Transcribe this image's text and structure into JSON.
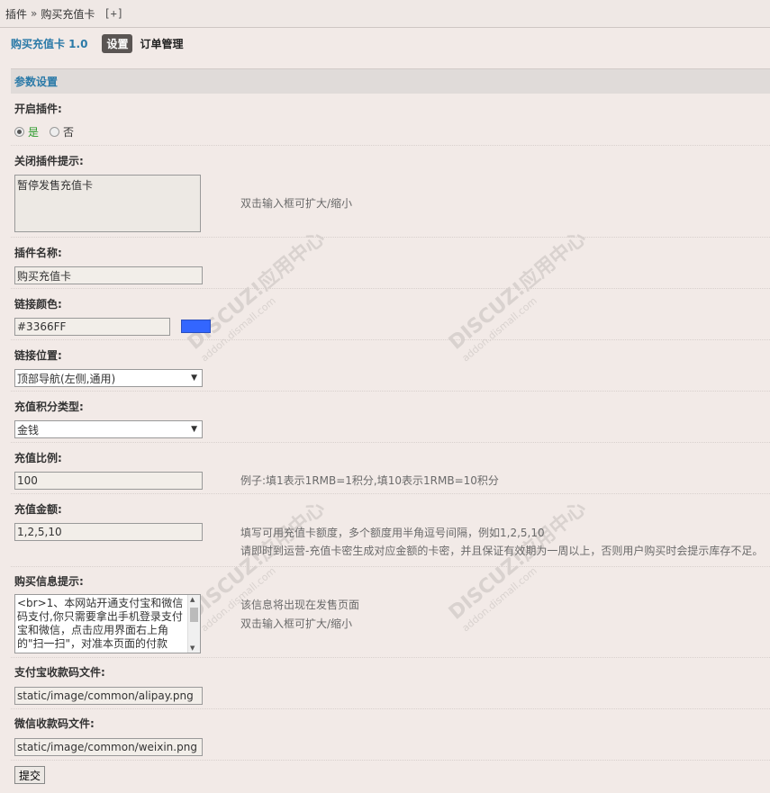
{
  "breadcrumb": {
    "root": "插件",
    "separator": "»",
    "current": "购买充值卡",
    "add": "[+]"
  },
  "tabs": {
    "plugin_title": "购买充值卡 1.0",
    "active": "设置",
    "other": "订单管理"
  },
  "section": {
    "title": "参数设置"
  },
  "fields": {
    "enable": {
      "label": "开启插件:",
      "yes": "是",
      "no": "否",
      "selected": "是"
    },
    "close_tip": {
      "label": "关闭插件提示:",
      "value": "暂停发售充值卡",
      "hint": "双击输入框可扩大/缩小"
    },
    "plugin_name": {
      "label": "插件名称:",
      "value": "购买充值卡"
    },
    "link_color": {
      "label": "链接颜色:",
      "value": "#3366FF",
      "swatch": "#3366FF"
    },
    "link_position": {
      "label": "链接位置:",
      "value": "顶部导航(左侧,通用)"
    },
    "credit_type": {
      "label": "充值积分类型:",
      "value": "金钱"
    },
    "ratio": {
      "label": "充值比例:",
      "value": "100",
      "hint": "例子:填1表示1RMB=1积分,填10表示1RMB=10积分"
    },
    "amounts": {
      "label": "充值金额:",
      "value": "1,2,5,10",
      "hint1": "填写可用充值卡额度，多个额度用半角逗号间隔，例如1,2,5,10",
      "hint2": "请即时到运营-充值卡密生成对应金额的卡密，并且保证有效期为一周以上，否则用户购买时会提示库存不足。"
    },
    "purchase_info": {
      "label": "购买信息提示:",
      "value": "<br>1、本网站开通支付宝和微信码支付,你只需要拿出手机登录支付宝和微信，点击应用界面右上角的\"扫一扫\"，对准本页面的付款",
      "hint1": "该信息将出现在发售页面",
      "hint2": "双击输入框可扩大/缩小"
    },
    "alipay_file": {
      "label": "支付宝收款码文件:",
      "value": "static/image/common/alipay.png"
    },
    "weixin_file": {
      "label": "微信收款码文件:",
      "value": "static/image/common/weixin.png"
    }
  },
  "submit_label": "提交"
}
